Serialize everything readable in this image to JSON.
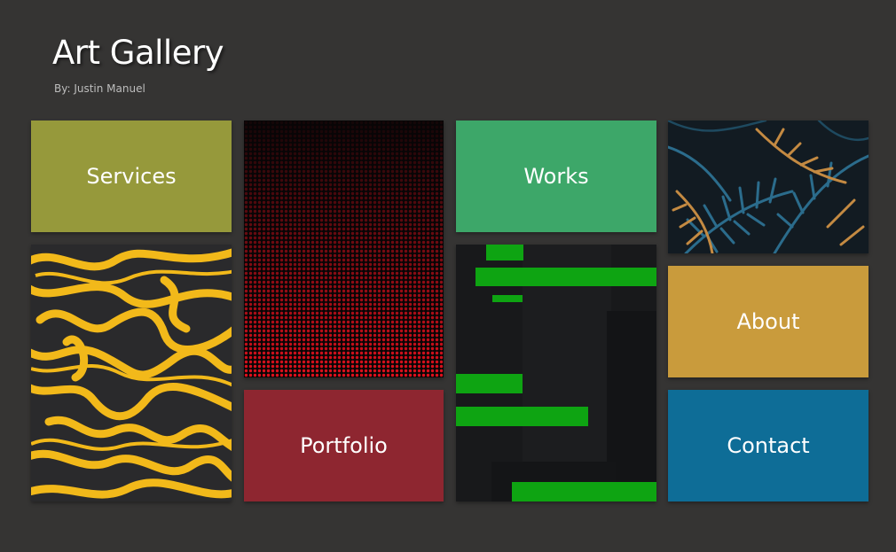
{
  "header": {
    "title": "Art Gallery",
    "subtitle": "By: Justin Manuel"
  },
  "tiles": {
    "services": {
      "label": "Services",
      "color": "#96993b"
    },
    "works": {
      "label": "Works",
      "color": "#3da769"
    },
    "about": {
      "label": "About",
      "color": "#c99b3c"
    },
    "contact": {
      "label": "Contact",
      "color": "#0e6d97"
    },
    "portfolio": {
      "label": "Portfolio",
      "color": "#8e2630"
    }
  },
  "images": {
    "swirl": {
      "colors": [
        "#2a2a2c",
        "#f2b91a"
      ]
    },
    "dots": {
      "colors": [
        "#080506",
        "#e0101c"
      ]
    },
    "bars": {
      "colors": [
        "#18191b",
        "#0ea412"
      ]
    },
    "leaves": {
      "colors": [
        "#121b22",
        "#2b6c8c",
        "#c48a42"
      ]
    }
  }
}
